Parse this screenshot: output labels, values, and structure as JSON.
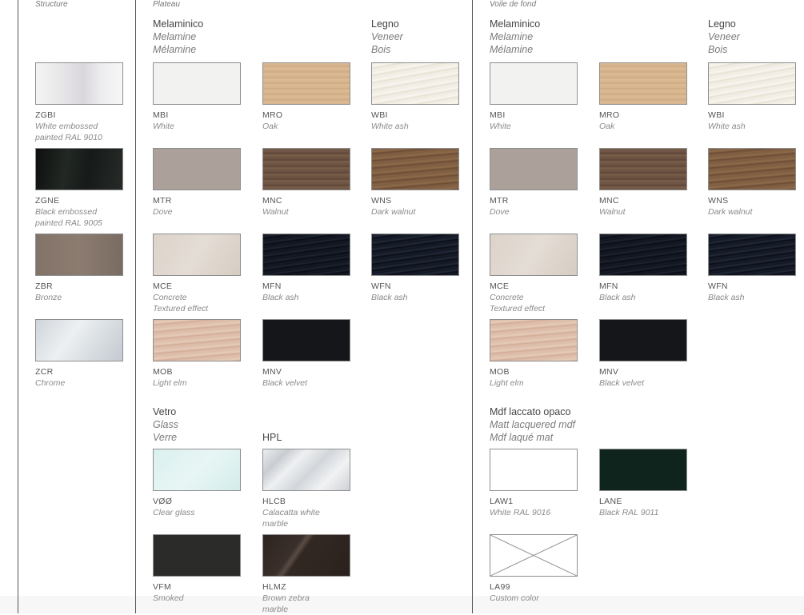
{
  "headers": {
    "structure": "Structure",
    "plateau": "Plateau",
    "voile": "Voile de fond"
  },
  "plateau": {
    "melaminico": {
      "it": "Melaminico",
      "en": "Melamine",
      "fr": "Mélamine"
    },
    "legno": {
      "it": "Legno",
      "en": "Veneer",
      "fr": "Bois"
    },
    "vetro": {
      "it": "Vetro",
      "en": "Glass",
      "fr": "Verre"
    },
    "hpl": "HPL"
  },
  "voile": {
    "melaminico": {
      "it": "Melaminico",
      "en": "Melamine",
      "fr": "Mélamine"
    },
    "legno": {
      "it": "Legno",
      "en": "Veneer",
      "fr": "Bois"
    },
    "mdf": {
      "it": "Mdf laccato opaco",
      "en": "Matt lacquered mdf",
      "fr": "Mdf laqué mat"
    }
  },
  "finishes": {
    "zgbi": {
      "code": "ZGBI",
      "name": "White embossed",
      "name2": "painted RAL 9010"
    },
    "zgne": {
      "code": "ZGNE",
      "name": "Black embossed",
      "name2": "painted RAL 9005"
    },
    "zbr": {
      "code": "ZBR",
      "name": "Bronze"
    },
    "zcr": {
      "code": "ZCR",
      "name": "Chrome"
    },
    "mbi": {
      "code": "MBI",
      "name": "White"
    },
    "mro": {
      "code": "MRO",
      "name": "Oak"
    },
    "wbi": {
      "code": "WBI",
      "name": "White ash"
    },
    "mtr": {
      "code": "MTR",
      "name": "Dove"
    },
    "mnc": {
      "code": "MNC",
      "name": "Walnut"
    },
    "wns": {
      "code": "WNS",
      "name": "Dark walnut"
    },
    "mce": {
      "code": "MCE",
      "name": "Concrete",
      "name2": "Textured effect"
    },
    "mfn": {
      "code": "MFN",
      "name": "Black ash"
    },
    "wfn": {
      "code": "WFN",
      "name": "Black ash"
    },
    "mob": {
      "code": "MOB",
      "name": "Light elm"
    },
    "mnv": {
      "code": "MNV",
      "name": "Black velvet"
    },
    "v00": {
      "code": "VØØ",
      "name": "Clear glass"
    },
    "hlcb": {
      "code": "HLCB",
      "name": "Calacatta white",
      "name2": "marble"
    },
    "vfm": {
      "code": "VFM",
      "name": "Smoked"
    },
    "hlmz": {
      "code": "HLMZ",
      "name": "Brown zebra",
      "name2": "marble"
    },
    "law1": {
      "code": "LAW1",
      "name": "White RAL 9016"
    },
    "lane": {
      "code": "LANE",
      "name": "Black RAL 9011"
    },
    "la99": {
      "code": "LA99",
      "name": "Custom color"
    }
  }
}
